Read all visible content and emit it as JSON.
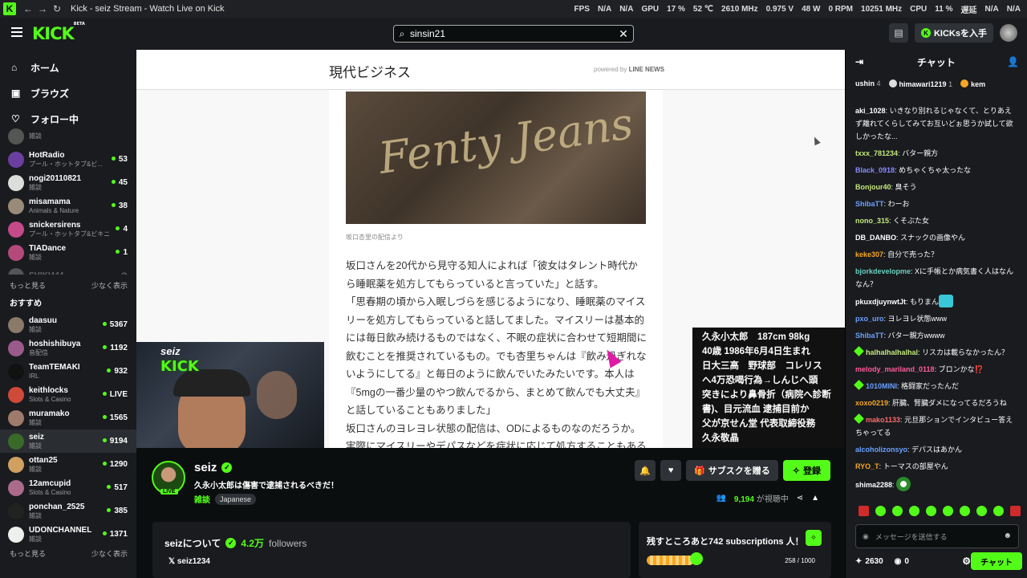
{
  "browser": {
    "title": "Kick - seiz Stream - Watch Live on Kick",
    "stats": [
      "FPS",
      "N/A",
      "N/A",
      "GPU",
      "17 %",
      "52 ℃",
      "2610 MHz",
      "0.975 V",
      "48 W",
      "0 RPM",
      "10251 MHz",
      "CPU",
      "11 %",
      "遅延",
      "N/A",
      "N/A"
    ]
  },
  "topnav": {
    "logo": "KICK",
    "logo_beta": "BETA",
    "search_value": "sinsin21",
    "kicks_label": "KICKsを入手"
  },
  "sidebar": {
    "nav": [
      {
        "label": "ホーム",
        "icon": "home-icon"
      },
      {
        "label": "ブラウズ",
        "icon": "browse-icon"
      },
      {
        "label": "フォロー中",
        "icon": "heart-icon"
      }
    ],
    "following": [
      {
        "name": "",
        "category": "雑談",
        "viewers": ""
      },
      {
        "name": "HotRadio",
        "category": "プール・ホットタブ&ビ...",
        "viewers": "53",
        "color": "#6b3fa0"
      },
      {
        "name": "nogi20110821",
        "category": "雑談",
        "viewers": "45",
        "color": "#ddd"
      },
      {
        "name": "misamama",
        "category": "Animals & Nature",
        "viewers": "38",
        "color": "#9a8a7a"
      },
      {
        "name": "snickersirens",
        "category": "プール・ホットタブ&ビキニ",
        "viewers": "4",
        "color": "#c44a8a"
      },
      {
        "name": "TIADance",
        "category": "雑談",
        "viewers": "1",
        "color": "#b44a7a"
      },
      {
        "name": "SHIKI444",
        "category": "",
        "viewers": "",
        "color": "#555"
      }
    ],
    "show_more": "もっと見る",
    "show_less": "少なく表示",
    "recommended_title": "おすすめ",
    "recommended": [
      {
        "name": "daasuu",
        "category": "雑談",
        "viewers": "5367",
        "color": "#8a7a6a"
      },
      {
        "name": "hoshishibuya",
        "category": "音配信",
        "viewers": "1192",
        "color": "#9a5a8a"
      },
      {
        "name": "TeamTEMAKI",
        "category": "IRL",
        "viewers": "932",
        "color": "#111"
      },
      {
        "name": "keithlocks",
        "category": "Slots & Casino",
        "viewers": "LIVE",
        "color": "#d04a3a"
      },
      {
        "name": "muramako",
        "category": "雑談",
        "viewers": "1565",
        "color": "#a07a6a"
      },
      {
        "name": "seiz",
        "category": "雑談",
        "viewers": "9194",
        "color": "#3a6a2a",
        "active": true
      },
      {
        "name": "ottan25",
        "category": "雑談",
        "viewers": "1290",
        "color": "#d0a060"
      },
      {
        "name": "12amcupid",
        "category": "Slots & Casino",
        "viewers": "517",
        "color": "#aa6a8a"
      },
      {
        "name": "ponchan_2525",
        "category": "雑談",
        "viewers": "385",
        "color": "#222"
      },
      {
        "name": "UDONCHANNEL",
        "category": "雑談",
        "viewers": "1371",
        "color": "#eee"
      }
    ]
  },
  "player": {
    "brand": "現代ビジネス",
    "powered_by": "powered by",
    "powered_name": "LINE NEWS",
    "photo_text": "Fenty Jeans",
    "caption": "坂口杏里の配信より",
    "paragraphs": [
      "坂口さんを20代から見守る知人によれば「彼女はタレント時代から睡眠薬を処方してもらっていると言っていた」と話す。",
      "「思春期の頃から入眠しづらを感じるようになり、睡眠薬のマイスリーを処方してもらっていると話してました。マイスリーは基本的には毎日飲み続けるものではなく、不眠の症状に合わせて短期間に飲むことを推奨されているもの。でも杏里ちゃんは『飲み過ぎれないようにしてる』と毎日のように飲んでいたみたいです。本人は『5mgの一番少量のやつ飲んでるから、まとめて飲んでも大丈夫』と話していることもありました」",
      "坂口さんのヨレヨレ状態の配信は、ODによるものなのだろうか。",
      "実際にマイスリーやデパスなどを症状に応じて処方することもある"
    ],
    "infobox": [
      "久永小太郎　187cm 98kg",
      "40歳 1986年6月4日生まれ",
      "日大三高　野球部　コレリス",
      "へ4万恐喝行為→しんじへ頭",
      "突きにより鼻骨折（病院へ診断",
      "書)、目元流血 逮捕目前か",
      "父が京せん堂 代表取締役務",
      "久永敬晶"
    ],
    "cam_logo": "seiz",
    "cam_kick": "KICK"
  },
  "stream": {
    "name": "seiz",
    "live": "LIVE",
    "title": "久永小太郎は傷害で逮捕されるべきだ！",
    "category": "雑談",
    "tag": "Japanese",
    "sub_button": "サブスクを贈る",
    "follow_button": "登録",
    "viewers": "9,194",
    "viewers_suffix": "が視聴中"
  },
  "about": {
    "title": "seizについて",
    "followers": "4.2万",
    "followers_label": "followers",
    "x_handle": "seiz1234"
  },
  "goal": {
    "text": "残すところあと742 subscriptions 人！",
    "progress": "258 / 1000",
    "fraction": 0.258
  },
  "chat": {
    "title": "チャット",
    "gifters": [
      {
        "name": "ushin",
        "count": "4"
      },
      {
        "name": "himawari1219",
        "count": "1"
      },
      {
        "name": "kem",
        "count": ""
      }
    ],
    "messages": [
      {
        "user": "aki_1028",
        "color": "#ffffff",
        "text": "いきなり別れるじゃなくて、とりあえず離れてくらしてみてお互いどぉ思うか試して欲しかったな..."
      },
      {
        "user": "txxx_781234",
        "color": "#c5e87a",
        "text": "バター親方"
      },
      {
        "user": "Black_0918",
        "color": "#8a8aff",
        "text": "めちゃくちゃ太ったな"
      },
      {
        "user": "Bonjour40",
        "color": "#c5e87a",
        "text": "臭そう"
      },
      {
        "user": "ShibaTT",
        "color": "#6aa0ff",
        "text": "わーお"
      },
      {
        "user": "nono_315",
        "color": "#c5e87a",
        "text": "くそぶた女"
      },
      {
        "user": "DB_DANBO",
        "color": "#ffffff",
        "text": "スナックの画像やん"
      },
      {
        "user": "keke307",
        "color": "#f5a623",
        "text": "自分で売った？"
      },
      {
        "user": "bjorkdevelopme",
        "color": "#6ad0c0",
        "text": "Xに手帳とか病気書く人はなんなん？"
      },
      {
        "user": "pkuxdjuynwtJt",
        "color": "#ffffff",
        "text": "もりまん",
        "emote": true
      },
      {
        "user": "pxo_uro",
        "color": "#6aa0ff",
        "text": "ヨレヨレ状態www"
      },
      {
        "user": "ShibaTT",
        "color": "#6aa0ff",
        "text": "バター親方wwww"
      },
      {
        "user": "halhalhalhalhal",
        "color": "#c5e87a",
        "text": "リスカは載らなかったん？",
        "badge": true
      },
      {
        "user": "melody_mariland_0118",
        "color": "#ff5a9a",
        "text": "ブロンかな⁉️"
      },
      {
        "user": "1010MINI",
        "color": "#6aa0ff",
        "text": "格闘家だったんだ",
        "badge": true
      },
      {
        "user": "xoxo0219",
        "color": "#f5a623",
        "text": "肝臓、腎臓ダメになってるだろうね"
      },
      {
        "user": "mako1133",
        "color": "#ff6a6a",
        "text": "元旦那ションでインタビュー答えちゃってる",
        "badge": true
      },
      {
        "user": "alcoholizonsyo",
        "color": "#6aa0ff",
        "text": "デパスはあかん"
      },
      {
        "user": "RYO_T",
        "color": "#f5a623",
        "text": "トーマスの部屋やん"
      },
      {
        "user": "shima2288",
        "color": "#ffffff",
        "text": "",
        "emote2": true
      }
    ],
    "input_placeholder": "メッセージを送信する",
    "kicks_count": "2630",
    "points": "0",
    "send_button": "チャット"
  }
}
